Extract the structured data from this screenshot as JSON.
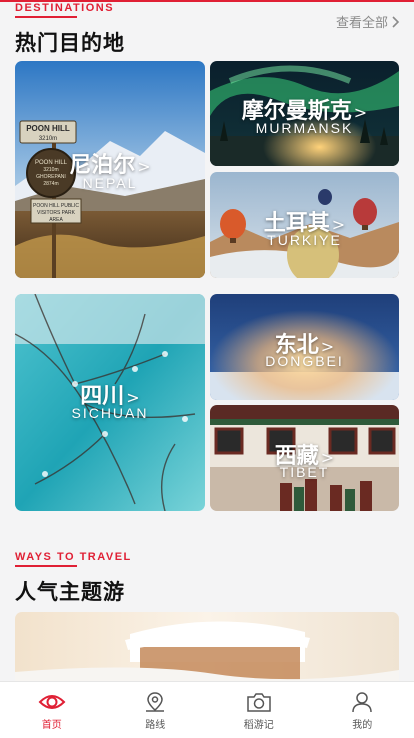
{
  "destinations": {
    "eyebrow": "DESTINATIONS",
    "title": "热门目的地",
    "see_all": "查看全部",
    "cards": [
      {
        "cn": "尼泊尔",
        "en": "NEPAL"
      },
      {
        "cn": "摩尔曼斯克",
        "en": "MURMANSK"
      },
      {
        "cn": "土耳其",
        "en": "TURKIYE"
      },
      {
        "cn": "四川",
        "en": "SICHUAN"
      },
      {
        "cn": "东北",
        "en": "DONGBEI"
      },
      {
        "cn": "西藏",
        "en": "TIBET"
      }
    ],
    "sign_text": [
      "POON HILL",
      "3210m",
      "POON HILL",
      "3210m",
      "GHOREPANI",
      "2874m",
      "POON HILL PUBLIC",
      "VISITORS PARK",
      "AREA"
    ]
  },
  "themes": {
    "eyebrow": "WAYS TO TRAVEL",
    "title": "人气主题游"
  },
  "nav": [
    {
      "label": "首页",
      "icon": "eye-icon",
      "active": true
    },
    {
      "label": "路线",
      "icon": "map-pin-icon",
      "active": false
    },
    {
      "label": "稻游记",
      "icon": "camera-icon",
      "active": false
    },
    {
      "label": "我的",
      "icon": "user-icon",
      "active": false
    }
  ],
  "colors": {
    "accent": "#e02035"
  }
}
